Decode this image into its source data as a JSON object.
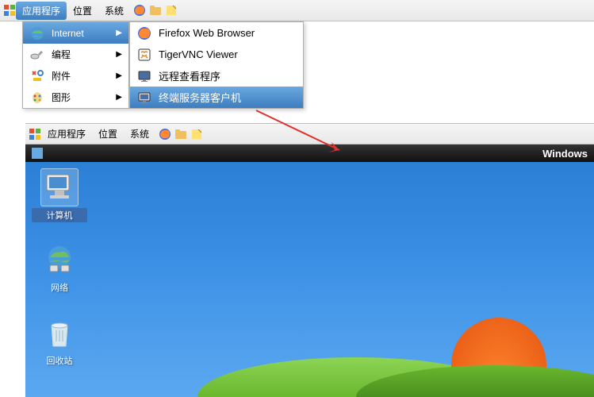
{
  "menubar": {
    "applications": "应用程序",
    "places": "位置",
    "system": "系统"
  },
  "dropdown": {
    "internet": "Internet",
    "programming": "编程",
    "accessories": "附件",
    "graphics": "图形"
  },
  "submenu": {
    "firefox": "Firefox Web Browser",
    "tigervnc": "TigerVNC Viewer",
    "remote_viewer": "远程查看程序",
    "terminal_server": "终端服务器客户机"
  },
  "menubar2": {
    "applications": "应用程序",
    "places": "位置",
    "system": "系统"
  },
  "titlebar": {
    "text": "Windows"
  },
  "desktop": {
    "computer": "计算机",
    "network": "网络",
    "recycle_bin": "回收站"
  }
}
